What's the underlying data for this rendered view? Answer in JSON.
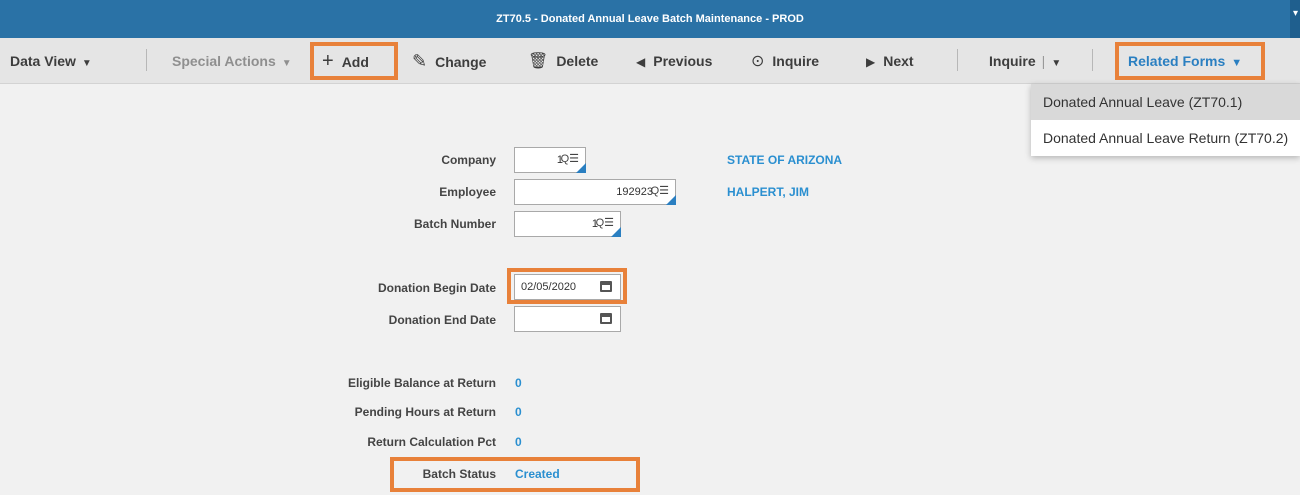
{
  "window": {
    "title": "ZT70.5 - Donated Annual Leave Batch Maintenance - PROD"
  },
  "toolbar": {
    "data_view": "Data View",
    "special_actions": "Special Actions",
    "add": "Add",
    "change": "Change",
    "delete": "Delete",
    "previous": "Previous",
    "inquire": "Inquire",
    "next": "Next",
    "inquire_menu": "Inquire",
    "related_forms": "Related Forms"
  },
  "related_forms_menu": [
    {
      "label": "Donated Annual Leave (ZT70.1)"
    },
    {
      "label": "Donated Annual Leave Return (ZT70.2)"
    }
  ],
  "form": {
    "company": {
      "label": "Company",
      "value": "1",
      "name": "STATE OF ARIZONA"
    },
    "employee": {
      "label": "Employee",
      "value": "192923",
      "name": "HALPERT, JIM"
    },
    "batch_number": {
      "label": "Batch Number",
      "value": "1"
    },
    "donation_begin_date": {
      "label": "Donation Begin Date",
      "value": "02/05/2020"
    },
    "donation_end_date": {
      "label": "Donation End Date",
      "value": ""
    },
    "eligible_balance": {
      "label": "Eligible Balance at Return",
      "value": "0"
    },
    "pending_hours": {
      "label": "Pending Hours at Return",
      "value": "0"
    },
    "return_calc_pct": {
      "label": "Return Calculation Pct",
      "value": "0"
    },
    "batch_status": {
      "label": "Batch Status",
      "value": "Created"
    }
  },
  "colors": {
    "titlebar": "#2a72a6",
    "highlight": "#e8813a",
    "link": "#2a8fd0"
  }
}
